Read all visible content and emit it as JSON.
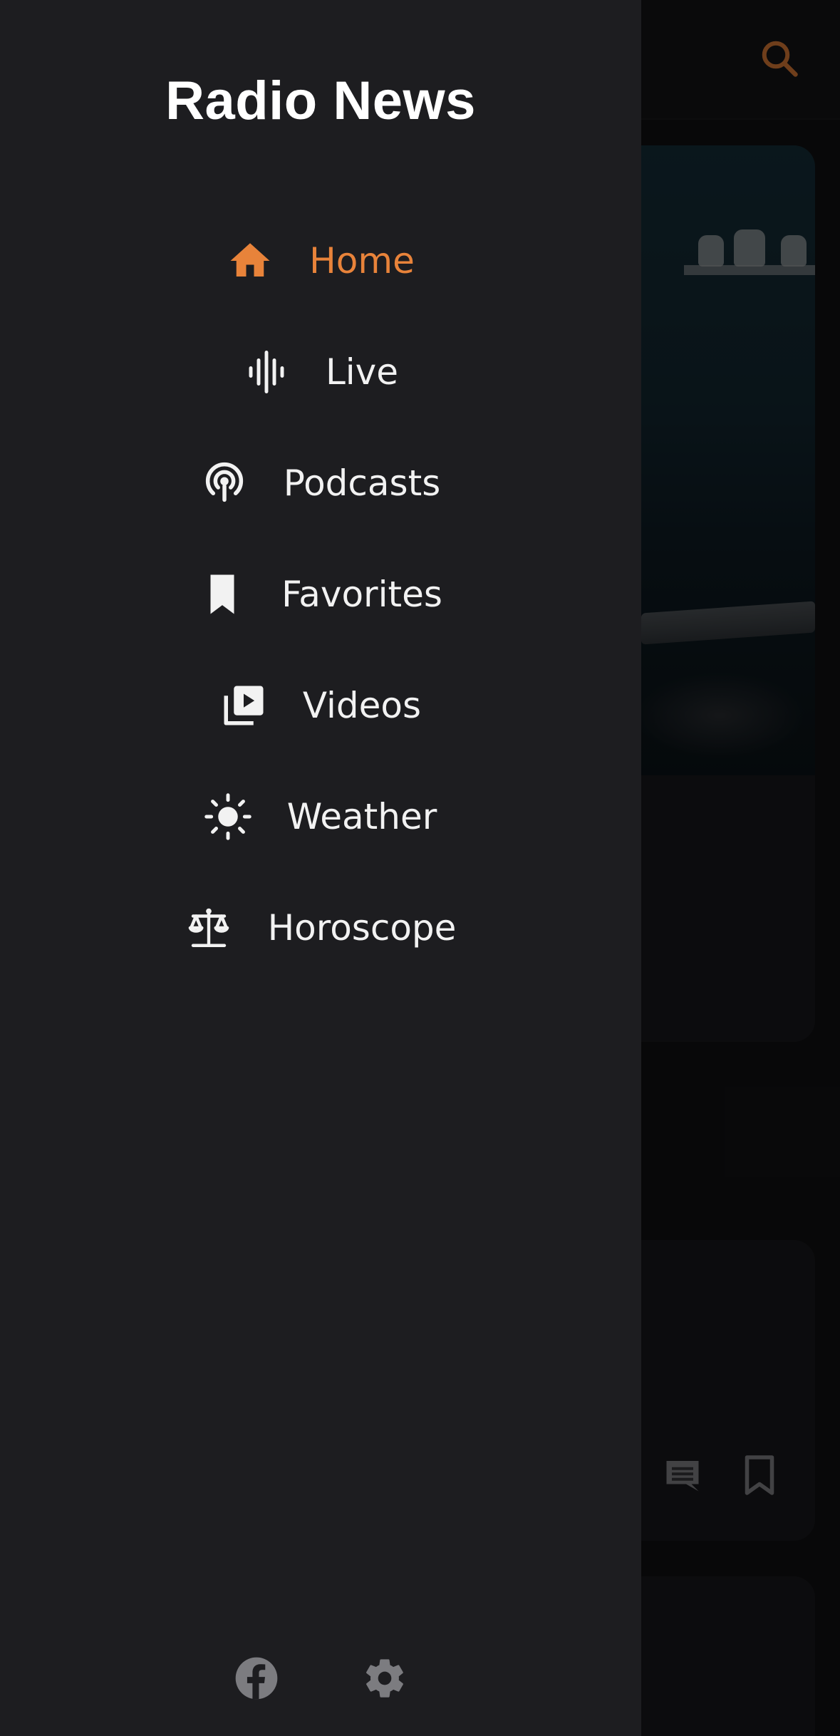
{
  "colors": {
    "accent": "#e8833a",
    "drawer_bg": "#1d1d20",
    "text": "#f2f2f2",
    "footer_icon": "#7c7c80"
  },
  "drawer": {
    "title": "Radio News",
    "menu": [
      {
        "label": "Home",
        "icon": "home-icon",
        "active": true
      },
      {
        "label": "Live",
        "icon": "audio-waveform-icon",
        "active": false
      },
      {
        "label": "Podcasts",
        "icon": "podcast-icon",
        "active": false
      },
      {
        "label": "Favorites",
        "icon": "bookmark-icon",
        "active": false
      },
      {
        "label": "Videos",
        "icon": "video-library-icon",
        "active": false
      },
      {
        "label": "Weather",
        "icon": "sun-icon",
        "active": false
      },
      {
        "label": "Horoscope",
        "icon": "libra-scales-icon",
        "active": false
      }
    ],
    "footer": [
      {
        "icon": "facebook-icon"
      },
      {
        "icon": "gear-icon"
      }
    ]
  },
  "background": {
    "topbar_icons": [
      "search-icon"
    ],
    "card_actions": [
      "comment-icon",
      "bookmark-outline-icon"
    ]
  }
}
